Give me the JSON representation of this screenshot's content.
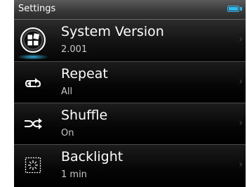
{
  "status_bar": {
    "title": "Settings",
    "battery_icon": "battery-icon",
    "accent_color": "#2fb9ee"
  },
  "menu": {
    "items": [
      {
        "label": "System Version",
        "value": "2.001",
        "icon": "system-version-icon",
        "chevron": "›"
      },
      {
        "label": "Repeat",
        "value": "All",
        "icon": "repeat-icon",
        "chevron": "›"
      },
      {
        "label": "Shuffle",
        "value": "On",
        "icon": "shuffle-icon",
        "chevron": "›"
      },
      {
        "label": "Backlight",
        "value": "1 min",
        "icon": "backlight-icon",
        "chevron": "›"
      }
    ]
  }
}
